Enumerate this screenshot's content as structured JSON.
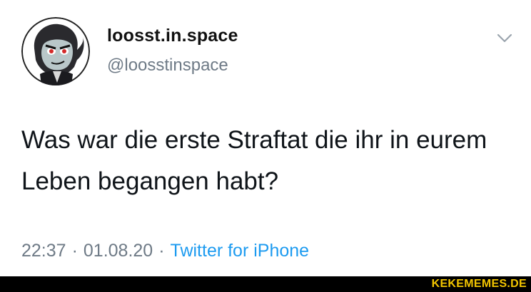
{
  "tweet": {
    "display_name": "loosst.in.space",
    "handle": "@loosstinspace",
    "text": "Was war die erste Straftat die ihr in eurem Leben begangen habt?",
    "time": "22:37",
    "date": "01.08.20",
    "separator": "·",
    "source": "Twitter for iPhone",
    "menu_icon": "chevron-down-icon",
    "avatar_icon": "cartoon-character-avatar"
  },
  "footer": {
    "watermark": "KEKEMEMES.DE"
  },
  "colors": {
    "text": "#0f1419",
    "secondary": "#6e7a86",
    "link": "#1d9bf0",
    "footer_bg": "#000000",
    "watermark": "#f2c500"
  }
}
